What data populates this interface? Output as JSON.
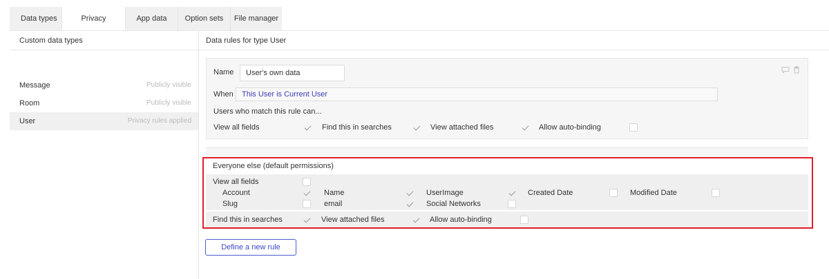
{
  "tabs": [
    {
      "label": "Data types"
    },
    {
      "label": "Privacy"
    },
    {
      "label": "App data"
    },
    {
      "label": "Option sets"
    },
    {
      "label": "File manager"
    }
  ],
  "active_tab": "Privacy",
  "sidebar": {
    "title": "Custom data types",
    "items": [
      {
        "name": "Message",
        "status": "Publicly visible"
      },
      {
        "name": "Room",
        "status": "Publicly visible"
      },
      {
        "name": "User",
        "status": "Privacy rules applied"
      }
    ]
  },
  "main": {
    "title": "Data rules for type User",
    "rule": {
      "name_label": "Name",
      "name_value": "User's own data",
      "when_label": "When",
      "when_value": "This User is Current User",
      "match_text": "Users who match this rule can...",
      "permissions": [
        {
          "label": "View all fields",
          "checked": true
        },
        {
          "label": "Find this in searches",
          "checked": true
        },
        {
          "label": "View attached files",
          "checked": true
        },
        {
          "label": "Allow auto-binding",
          "checked": false
        }
      ]
    },
    "default": {
      "title": "Everyone else (default permissions)",
      "view_all_fields": {
        "label": "View all fields",
        "checked": false
      },
      "fields": [
        {
          "label": "Account",
          "checked": true
        },
        {
          "label": "Name",
          "checked": true
        },
        {
          "label": "UserImage",
          "checked": true
        },
        {
          "label": "Created Date",
          "checked": false
        },
        {
          "label": "Modified Date",
          "checked": false
        },
        {
          "label": "Slug",
          "checked": false
        },
        {
          "label": "email",
          "checked": true
        },
        {
          "label": "Social Networks",
          "checked": false
        }
      ],
      "permissions": [
        {
          "label": "Find this in searches",
          "checked": true
        },
        {
          "label": "View attached files",
          "checked": true
        },
        {
          "label": "Allow auto-binding",
          "checked": false
        }
      ]
    },
    "define_button": "Define a new rule"
  },
  "icons": [
    "comment-icon",
    "trash-icon"
  ],
  "colors": {
    "highlight_border": "#e11d2a",
    "link_blue": "#3b46c9"
  }
}
